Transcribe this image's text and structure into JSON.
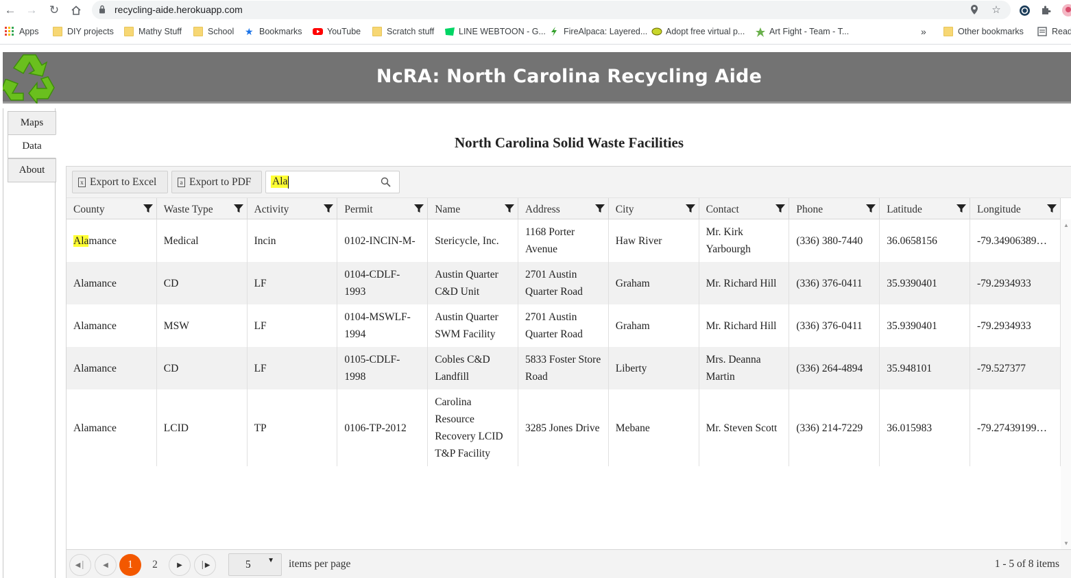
{
  "browser": {
    "url": "recycling-aide.herokuapp.com",
    "bookmarks": [
      {
        "label": "Apps",
        "icon": "apps-grid-icon"
      },
      {
        "label": "DIY projects",
        "icon": "folder-icon"
      },
      {
        "label": "Mathy Stuff",
        "icon": "folder-icon"
      },
      {
        "label": "School",
        "icon": "folder-icon"
      },
      {
        "label": "Bookmarks",
        "icon": "star-icon"
      },
      {
        "label": "YouTube",
        "icon": "youtube-icon"
      },
      {
        "label": "Scratch stuff",
        "icon": "folder-icon"
      },
      {
        "label": "LINE WEBTOON - G...",
        "icon": "webtoon-icon"
      },
      {
        "label": "FireAlpaca: Layered...",
        "icon": "firealpaca-icon"
      },
      {
        "label": "Adopt free virtual p...",
        "icon": "virtual-pet-icon"
      },
      {
        "label": "Art Fight - Team - T...",
        "icon": "artfight-icon"
      },
      {
        "label": "Other bookmarks",
        "icon": "folder-icon"
      },
      {
        "label": "Read",
        "icon": "reading-list-icon"
      }
    ],
    "overflow_label": "»"
  },
  "app": {
    "title": "NcRA: North Carolina Recycling Aide",
    "logo_icon": "recycle-logo-icon",
    "brand_color": "#737373"
  },
  "nav": {
    "tabs": [
      {
        "label": "Maps",
        "active": false
      },
      {
        "label": "Data",
        "active": true
      },
      {
        "label": "About",
        "active": false
      }
    ]
  },
  "page": {
    "heading": "North Carolina Solid Waste Facilities"
  },
  "toolbar": {
    "export_excel": "Export to Excel",
    "export_pdf": "Export to PDF",
    "search_value": "Ala"
  },
  "table": {
    "columns": [
      "County",
      "Waste Type",
      "Activity",
      "Permit",
      "Name",
      "Address",
      "City",
      "Contact",
      "Phone",
      "Latitude",
      "Longitude"
    ],
    "rows": [
      [
        "Alamance",
        "Medical",
        "Incin",
        "0102-INCIN-M-",
        "Stericycle, Inc.",
        "1168 Porter Avenue",
        "Haw River",
        "Mr. Kirk Yarbourgh",
        "(336) 380-7440",
        "36.0658156",
        "-79.34906389…"
      ],
      [
        "Alamance",
        "CD",
        "LF",
        "0104-CDLF-1993",
        "Austin Quarter C&D Unit",
        "2701 Austin Quarter Road",
        "Graham",
        "Mr. Richard Hill",
        "(336) 376-0411",
        "35.9390401",
        "-79.2934933"
      ],
      [
        "Alamance",
        "MSW",
        "LF",
        "0104-MSWLF-1994",
        "Austin Quarter SWM Facility",
        "2701 Austin Quarter Road",
        "Graham",
        "Mr. Richard Hill",
        "(336) 376-0411",
        "35.9390401",
        "-79.2934933"
      ],
      [
        "Alamance",
        "CD",
        "LF",
        "0105-CDLF-1998",
        "Cobles C&D Landfill",
        "5833 Foster Store Road",
        "Liberty",
        "Mrs. Deanna Martin",
        "(336) 264-4894",
        "35.948101",
        "-79.527377"
      ],
      [
        "Alamance",
        "LCID",
        "TP",
        "0106-TP-2012",
        "Carolina Resource Recovery LCID T&P Facility",
        "3285 Jones Drive",
        "Mebane",
        "Mr. Steven Scott",
        "(336) 214-7229",
        "36.015983",
        "-79.27439199…"
      ]
    ]
  },
  "pager": {
    "pages": [
      "1",
      "2"
    ],
    "current_page": "1",
    "page_size": "5",
    "items_per_page_label": "items per page",
    "info": "1 - 5 of 8 items",
    "accent": "#f35800"
  }
}
